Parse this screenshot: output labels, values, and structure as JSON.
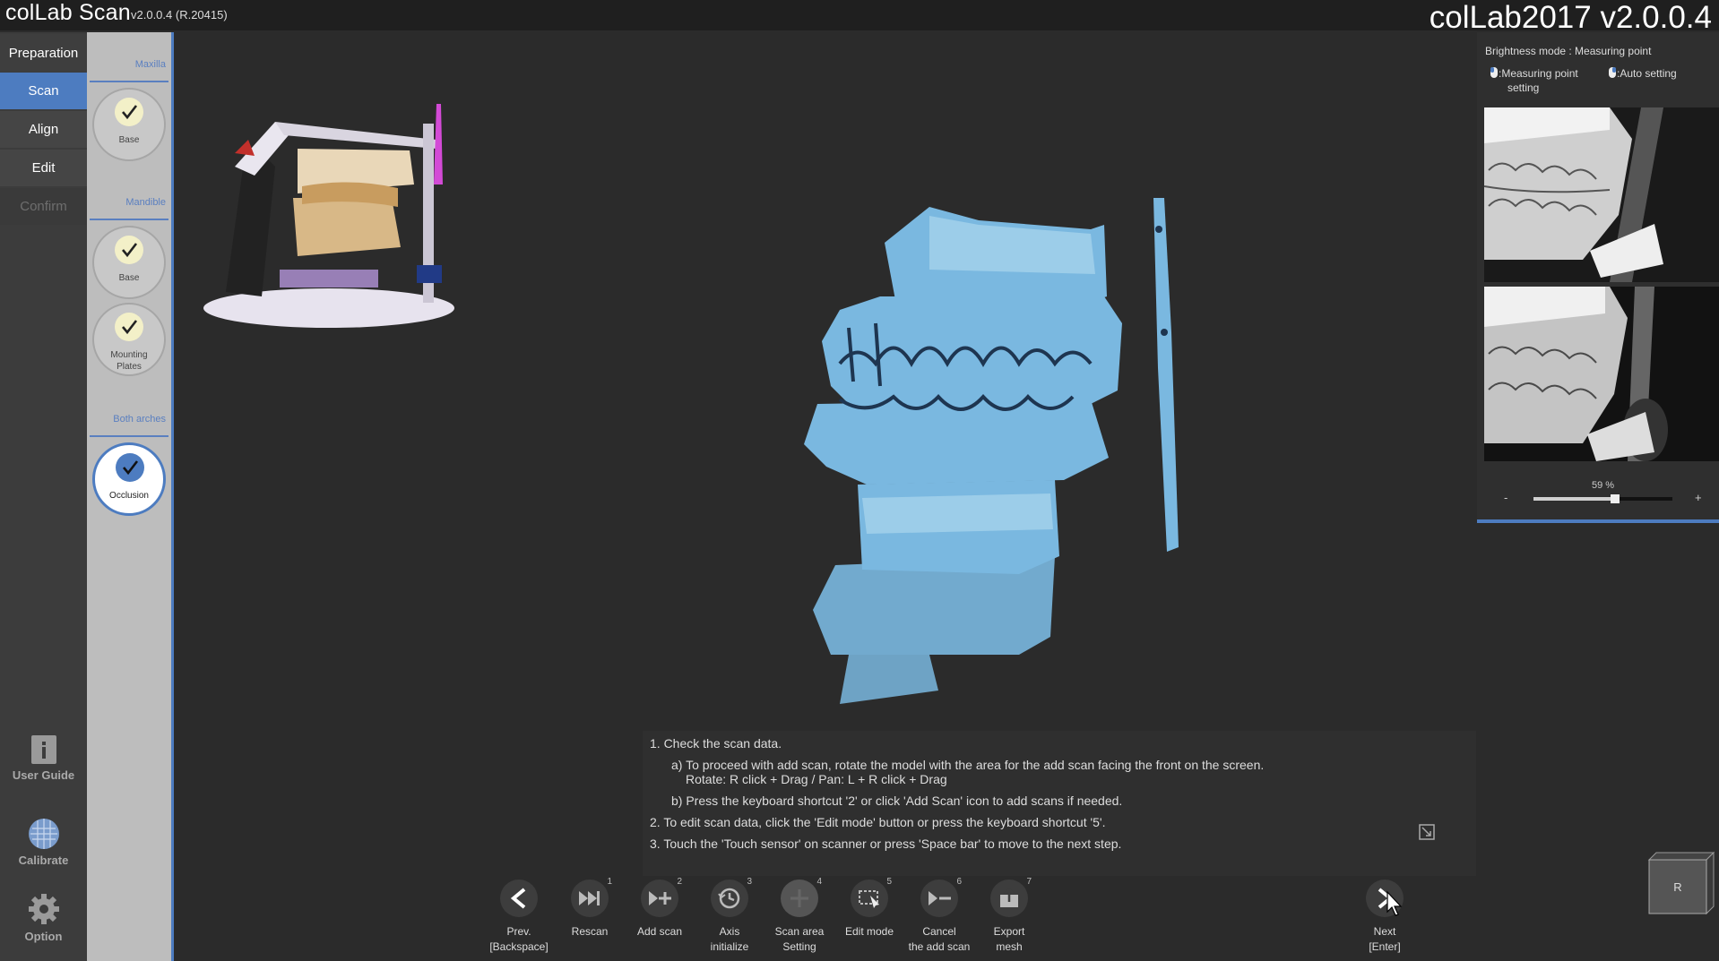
{
  "titlebar": {
    "app_name": "colLab Scan",
    "version": "v2.0.0.4 (R.20415)",
    "brand": "colLab2017 v2.0.0.4"
  },
  "nav": {
    "preparation": "Preparation",
    "scan": "Scan",
    "align": "Align",
    "edit": "Edit",
    "confirm": "Confirm"
  },
  "tools": {
    "user_guide": "User Guide",
    "calibrate": "Calibrate",
    "option": "Option"
  },
  "steps": {
    "maxilla": "Maxilla",
    "maxilla_base": "Base",
    "mandible": "Mandible",
    "mandible_base": "Base",
    "mounting_plates": "Mounting Plates",
    "both_arches": "Both arches",
    "occlusion": "Occlusion"
  },
  "instructions": {
    "line1": "1. Check the scan data.",
    "line1a": "a) To proceed with add scan, rotate the model with the area for the add scan facing the front on the screen.",
    "line1a2": "Rotate: R click + Drag / Pan: L + R click + Drag",
    "line1b": "b) Press the keyboard shortcut '2' or click 'Add Scan' icon to add scans if needed.",
    "line2": "2. To edit scan data, click the 'Edit mode' button or press the keyboard shortcut '5'.",
    "line3": "3. Touch the 'Touch sensor' on scanner or press 'Space bar' to move to the next step."
  },
  "toolbar": {
    "prev_l1": "Prev.",
    "prev_l2": "[Backspace]",
    "rescan": "Rescan",
    "rescan_num": "1",
    "add_scan": "Add scan",
    "add_scan_num": "2",
    "axis_l1": "Axis",
    "axis_l2": "initialize",
    "axis_num": "3",
    "scan_area_l1": "Scan area",
    "scan_area_l2": "Setting",
    "scan_area_num": "4",
    "edit_mode": "Edit mode",
    "edit_mode_num": "5",
    "cancel_l1": "Cancel",
    "cancel_l2": "the add scan",
    "cancel_num": "6",
    "export_l1": "Export",
    "export_l2": "mesh",
    "export_num": "7",
    "next_l1": "Next",
    "next_l2": "[Enter]"
  },
  "right_panel": {
    "title": "Brightness mode : Measuring point",
    "opt1_l1": ":Measuring point",
    "opt1_l2": "setting",
    "opt2": ":Auto setting",
    "percent": "59 %",
    "percent_value": 59,
    "minus": "-",
    "plus": "+"
  },
  "view_cube": {
    "face": "R"
  },
  "colors": {
    "accent": "#4d7cc0",
    "model": "#7ab8e0",
    "check_bg": "#f3f0c8"
  }
}
